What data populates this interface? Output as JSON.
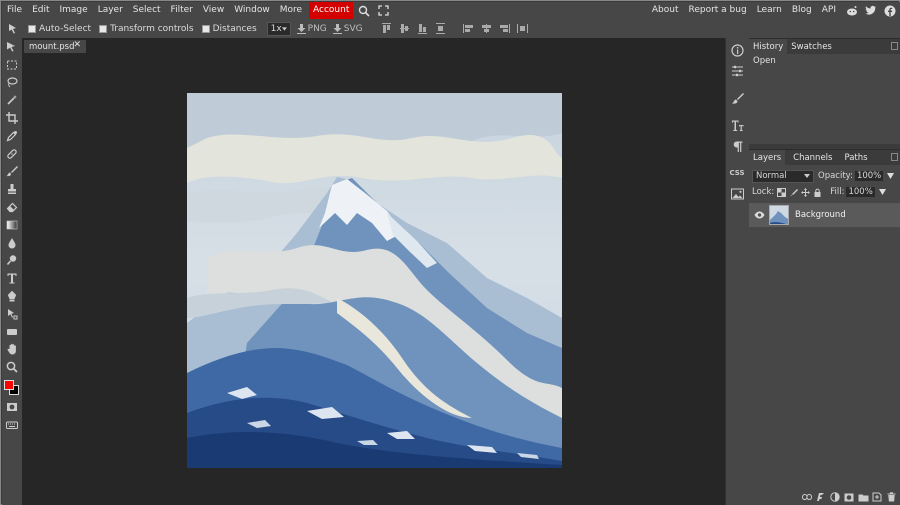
{
  "menu": {
    "items": [
      "File",
      "Edit",
      "Image",
      "Layer",
      "Select",
      "Filter",
      "View",
      "Window",
      "More"
    ],
    "account": "Account",
    "right": [
      "About",
      "Report a bug",
      "Learn",
      "Blog",
      "API"
    ],
    "social_icons": [
      "reddit-icon",
      "twitter-icon",
      "facebook-icon"
    ]
  },
  "options": {
    "auto_select": "Auto-Select",
    "transform_controls": "Transform controls",
    "distances": "Distances",
    "zoom": "1x",
    "png": "PNG",
    "svg": "SVG"
  },
  "document": {
    "tab_name": "mount.psd",
    "close": "✕"
  },
  "history": {
    "tabs": [
      "History",
      "Swatches"
    ],
    "entries": [
      "Open"
    ]
  },
  "layers": {
    "tabs": [
      "Layers",
      "Channels",
      "Paths"
    ],
    "blend_mode": "Normal",
    "opacity_label": "Opacity:",
    "opacity": "100%",
    "lock_label": "Lock:",
    "fill_label": "Fill:",
    "fill": "100%",
    "items": [
      {
        "name": "Background"
      }
    ]
  },
  "side_strip": {
    "css_label": "CSS"
  },
  "colors": {
    "foreground": "#ff0000",
    "background": "#000000",
    "account": "#d40000"
  }
}
